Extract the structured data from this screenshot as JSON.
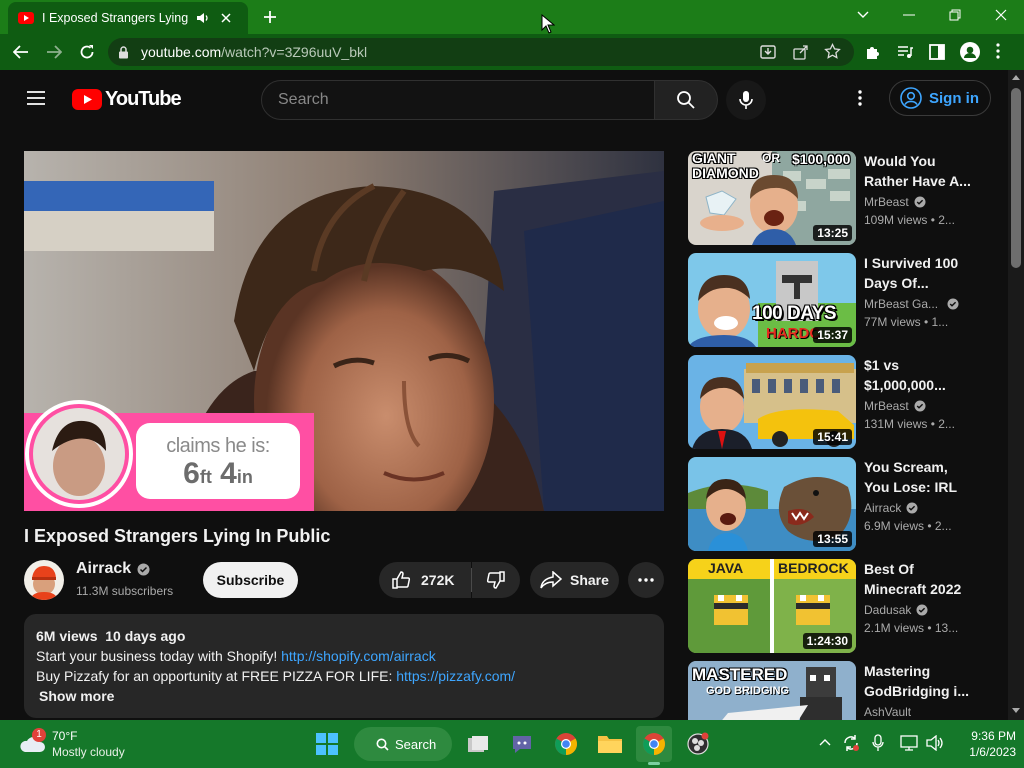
{
  "browser": {
    "tab_title": "I Exposed Strangers Lying In",
    "url_host": "youtube.com",
    "url_path": "/watch?v=3Z96uuV_bkl"
  },
  "masthead": {
    "logo_text": "YouTube",
    "search_placeholder": "Search",
    "signin_label": "Sign in"
  },
  "overlay": {
    "claim_line1": "claims he is:",
    "claim_line2a": "6",
    "claim_line2b": "ft",
    "claim_line2c": " 4",
    "claim_line2d": "in"
  },
  "video": {
    "title": "I Exposed Strangers Lying In Public",
    "channel": "Airrack",
    "subscribers": "11.3M subscribers",
    "subscribe_label": "Subscribe",
    "likes": "272K",
    "share_label": "Share",
    "desc_stats": "6M views  10 days ago",
    "desc_line1_text": "Start your business today with Shopify! ",
    "desc_line1_link": "http://shopify.com/airrack",
    "desc_line2_text": "Buy Pizzafy for an opportunity at FREE PIZZA FOR LIFE: ",
    "desc_line2_link": "https://pizzafy.com/",
    "show_more": "Show more"
  },
  "recommendations": [
    {
      "title": "Would You Rather Have A...",
      "channel": "MrBeast",
      "meta": "109M views  •  2...",
      "duration": "13:25",
      "thumb_text1": "GIANT",
      "thumb_text2": "DIAMOND",
      "thumb_text3": "OR",
      "thumb_text4": "$100,000"
    },
    {
      "title": "I Survived 100 Days Of...",
      "channel": "MrBeast Ga...",
      "meta": "77M views  •  1...",
      "duration": "15:37",
      "thumb_text1": "100 DAYS",
      "thumb_text2": "HARDC"
    },
    {
      "title": "$1 vs $1,000,000...",
      "channel": "MrBeast",
      "meta": "131M views  •  2...",
      "duration": "15:41"
    },
    {
      "title": "You Scream, You Lose: IRL",
      "channel": "Airrack",
      "meta": "6.9M views  •  2...",
      "duration": "13:55"
    },
    {
      "title": "Best Of Minecraft 2022",
      "channel": "Dadusak",
      "meta": "2.1M views  •  13...",
      "duration": "1:24:30",
      "thumb_text1": "JAVA",
      "thumb_text2": "BEDROCK"
    },
    {
      "title": "Mastering GodBridging i...",
      "channel": "AshVault",
      "meta": "",
      "duration": "",
      "thumb_text1": "MASTERED",
      "thumb_text2": "GOD BRIDGING"
    }
  ],
  "taskbar": {
    "weather_badge": "1",
    "temperature": "70°F",
    "condition": "Mostly cloudy",
    "search_label": "Search",
    "time": "9:36 PM",
    "date": "1/6/2023"
  },
  "colors": {
    "tabstrip": "#1c7d18",
    "toolbar": "#0f5c12",
    "taskbar": "#15782a",
    "youtube_red": "#ff0000",
    "link_blue": "#3ea6ff",
    "page_bg": "#0f0f0f"
  }
}
